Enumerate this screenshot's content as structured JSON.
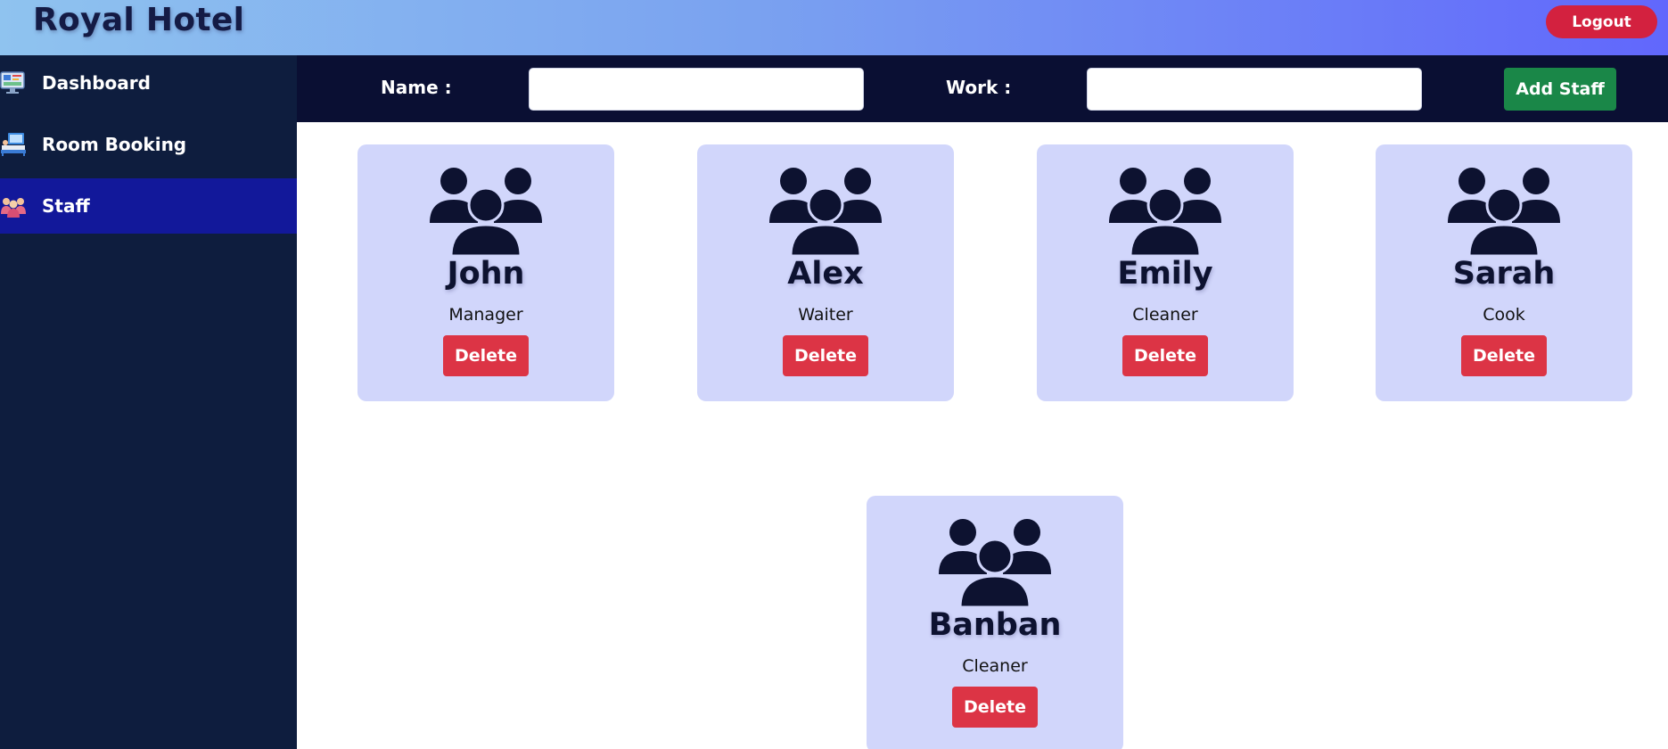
{
  "app": {
    "title": "Royal Hotel",
    "logout_label": "Logout"
  },
  "sidebar": {
    "items": [
      {
        "label": "Dashboard",
        "icon": "dashboard-icon",
        "active": false
      },
      {
        "label": "Room Booking",
        "icon": "room-booking-icon",
        "active": false
      },
      {
        "label": "Staff",
        "icon": "staff-icon",
        "active": true
      }
    ]
  },
  "form": {
    "name_label": "Name :",
    "name_value": "",
    "work_label": "Work :",
    "work_value": "",
    "add_label": "Add Staff"
  },
  "staff": [
    {
      "name": "John",
      "role": "Manager",
      "delete_label": "Delete"
    },
    {
      "name": "Alex",
      "role": "Waiter",
      "delete_label": "Delete"
    },
    {
      "name": "Emily",
      "role": "Cleaner",
      "delete_label": "Delete"
    },
    {
      "name": "Sarah",
      "role": "Cook",
      "delete_label": "Delete"
    },
    {
      "name": "Banban",
      "role": "Cleaner",
      "delete_label": "Delete"
    }
  ],
  "colors": {
    "sidebar_bg": "#0e1d3e",
    "active_item": "#12189a",
    "formbar_bg": "#0a0f33",
    "card_bg": "#d1d6fb",
    "delete": "#dc3445",
    "add": "#1a8748",
    "logout": "#d3213f"
  }
}
